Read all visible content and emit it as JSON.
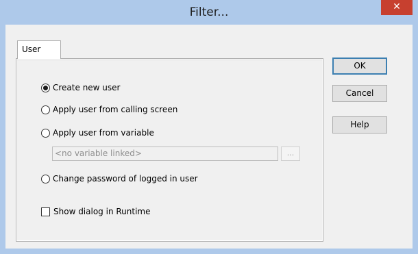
{
  "window": {
    "title": "Filter...",
    "close_glyph": "✕"
  },
  "tabs": [
    {
      "label": "User",
      "active": true
    }
  ],
  "options": {
    "create_new_user": {
      "label": "Create new user",
      "checked": true
    },
    "apply_from_calling_screen": {
      "label": "Apply user from calling screen",
      "checked": false
    },
    "apply_from_variable": {
      "label": "Apply user from variable",
      "checked": false
    },
    "change_password": {
      "label": "Change password of logged in user",
      "checked": false
    },
    "show_dialog_runtime": {
      "label": "Show dialog in Runtime",
      "checked": false
    }
  },
  "variable_field": {
    "placeholder": "<no variable linked>",
    "browse_label": "..."
  },
  "buttons": {
    "ok": "OK",
    "cancel": "Cancel",
    "help": "Help"
  },
  "colors": {
    "titlebar": "#aec9ea",
    "close_button": "#c7402f",
    "dialog_background": "#f0f0f0",
    "default_button_border": "#3c7fb1"
  },
  "icons": {
    "close": "close-icon"
  }
}
